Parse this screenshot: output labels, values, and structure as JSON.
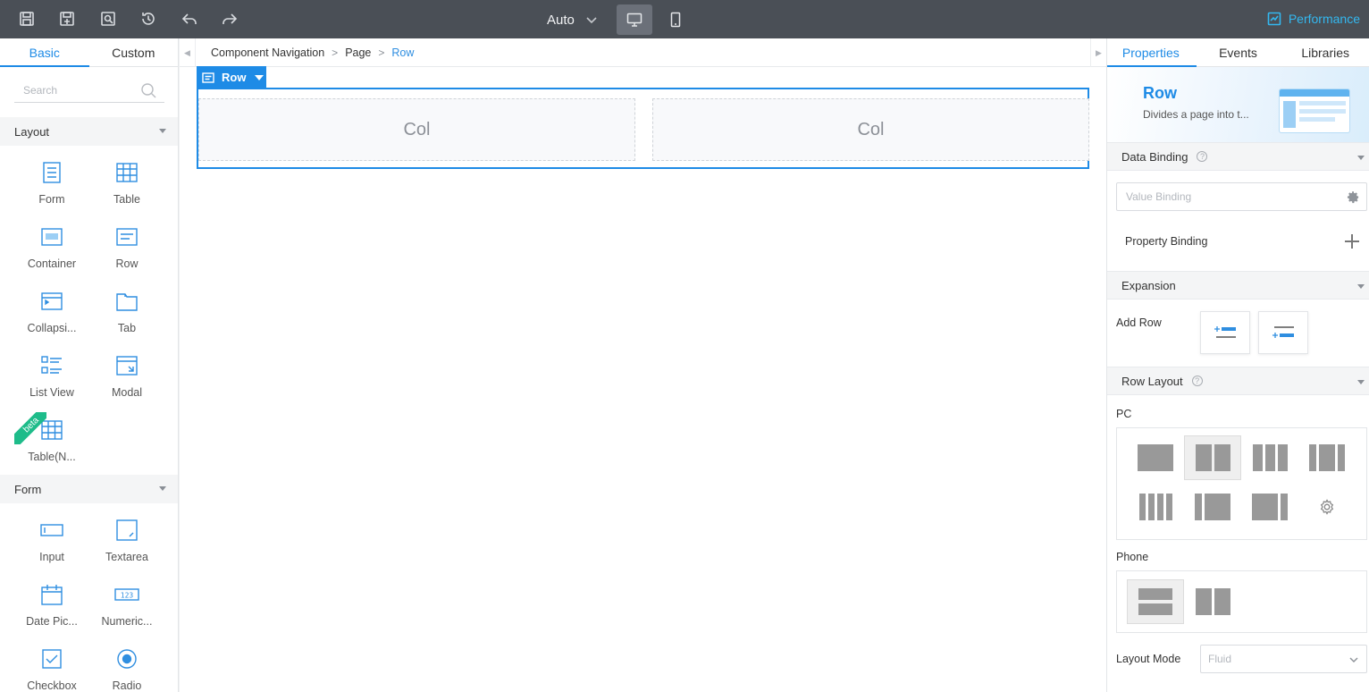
{
  "toolbar": {
    "viewport_value": "Auto",
    "performance_label": "Performance",
    "icons": [
      "save-icon",
      "save-as-icon",
      "preview-icon",
      "history-icon",
      "undo-icon",
      "redo-icon",
      "desktop-icon",
      "phone-icon",
      "chart-icon"
    ]
  },
  "left_panel": {
    "tabs": [
      "Basic",
      "Custom"
    ],
    "search_placeholder": "Search",
    "sections": {
      "layout": "Layout",
      "form": "Form"
    },
    "layout_components": [
      {
        "label": "Form",
        "icon": "form-icon"
      },
      {
        "label": "Table",
        "icon": "table-icon"
      },
      {
        "label": "Container",
        "icon": "container-icon"
      },
      {
        "label": "Row",
        "icon": "row-icon"
      },
      {
        "label": "Collapsi...",
        "icon": "collapse-icon"
      },
      {
        "label": "Tab",
        "icon": "tab-icon"
      },
      {
        "label": "List View",
        "icon": "list-view-icon"
      },
      {
        "label": "Modal",
        "icon": "modal-icon"
      },
      {
        "label": "Table(N...",
        "icon": "table-icon"
      }
    ],
    "beta_label": "beta",
    "form_components": [
      {
        "label": "Input",
        "icon": "input-icon"
      },
      {
        "label": "Textarea",
        "icon": "textarea-icon"
      },
      {
        "label": "Date Pic...",
        "icon": "calendar-icon"
      },
      {
        "label": "Numeric...",
        "icon": "numeric-icon"
      },
      {
        "label": "Checkbox",
        "icon": "checkbox-icon"
      },
      {
        "label": "Radio",
        "icon": "radio-icon"
      }
    ]
  },
  "canvas": {
    "breadcrumb": [
      "Component Navigation",
      "Page",
      "Row"
    ],
    "row_tag_label": "Row",
    "columns": [
      "Col",
      "Col"
    ]
  },
  "right_panel": {
    "tabs": [
      "Properties",
      "Events",
      "Libraries"
    ],
    "hero": {
      "title": "Row",
      "description": "Divides a page into t..."
    },
    "data_binding": {
      "title": "Data Binding",
      "value_binding_placeholder": "Value Binding",
      "property_binding_label": "Property Binding"
    },
    "expansion": {
      "title": "Expansion",
      "add_row_label": "Add Row"
    },
    "row_layout": {
      "title": "Row Layout",
      "pc_label": "PC",
      "phone_label": "Phone",
      "layout_mode_label": "Layout Mode",
      "layout_mode_value": "Fluid"
    },
    "colors": {
      "accent": "#1e8be6",
      "toolbar": "#4a4f56",
      "performance": "#33b8f0"
    }
  }
}
